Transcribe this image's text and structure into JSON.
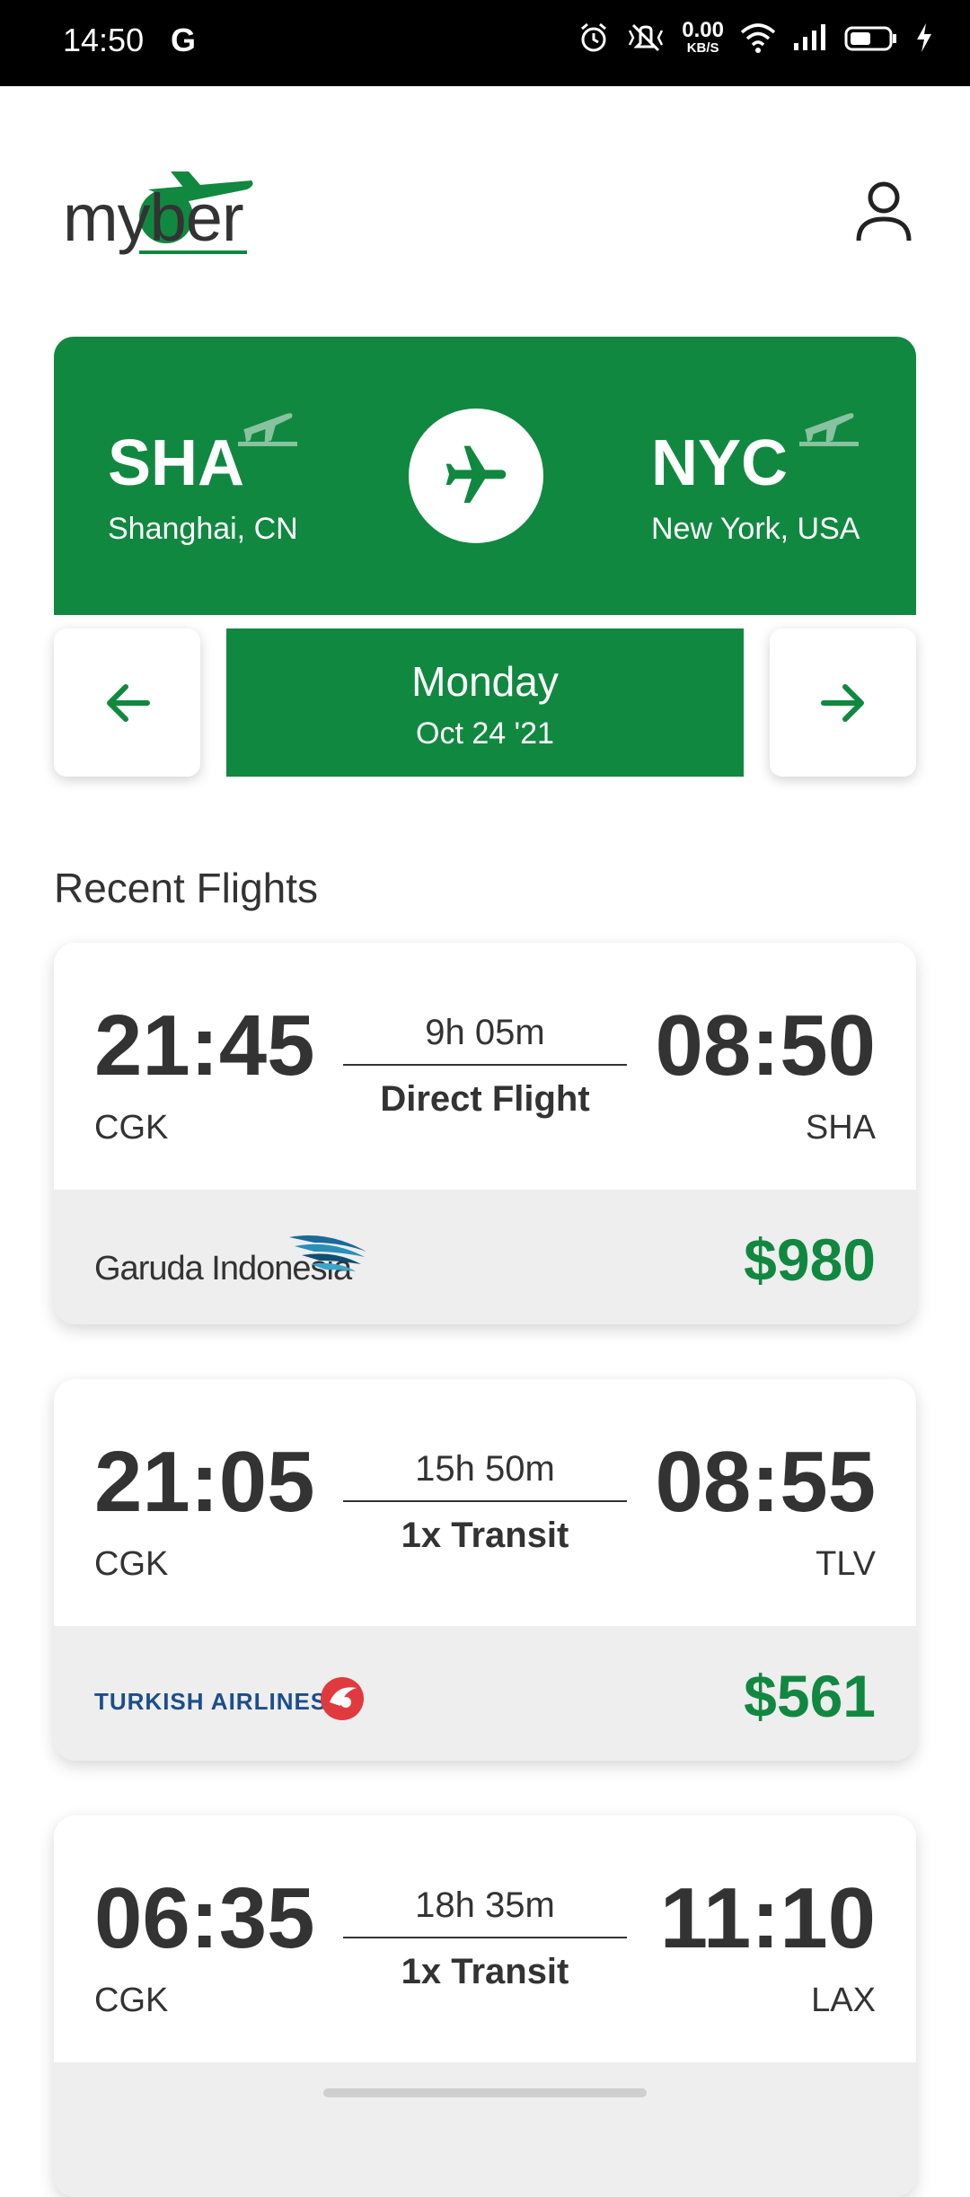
{
  "status_bar": {
    "time": "14:50",
    "carrier_icon": "G",
    "speed_value": "0.00",
    "speed_unit": "KB/S",
    "icons": [
      "alarm-icon",
      "vibrate-icon",
      "wifi-icon",
      "signal-icon",
      "battery-icon",
      "charging-icon"
    ]
  },
  "header": {
    "logo_text": "myber",
    "profile_icon": "user-icon"
  },
  "route": {
    "origin": {
      "code": "SHA",
      "city": "Shanghai, CN",
      "icon": "departure-icon"
    },
    "destination": {
      "code": "NYC",
      "city": "New York, USA",
      "icon": "departure-icon"
    },
    "swap_icon": "airplane-icon"
  },
  "date_nav": {
    "prev_icon": "arrow-left-icon",
    "next_icon": "arrow-right-icon",
    "day": "Monday",
    "date": "Oct 24 '21"
  },
  "section_title": "Recent Flights",
  "flights": [
    {
      "dep_time": "21:45",
      "dep_airport": "CGK",
      "arr_time": "08:50",
      "arr_airport": "SHA",
      "duration": "9h 05m",
      "type": "Direct Flight",
      "airline": "Garuda Indonesia",
      "price": "$980"
    },
    {
      "dep_time": "21:05",
      "dep_airport": "CGK",
      "arr_time": "08:55",
      "arr_airport": "TLV",
      "duration": "15h 50m",
      "type": "1x Transit",
      "airline": "TURKISH AIRLINES",
      "price": "$561"
    },
    {
      "dep_time": "06:35",
      "dep_airport": "CGK",
      "arr_time": "11:10",
      "arr_airport": "LAX",
      "duration": "18h 35m",
      "type": "1x Transit"
    }
  ],
  "colors": {
    "brand_green": "#118840",
    "text_dark": "#333333",
    "footer_gray": "#eeeeee"
  }
}
